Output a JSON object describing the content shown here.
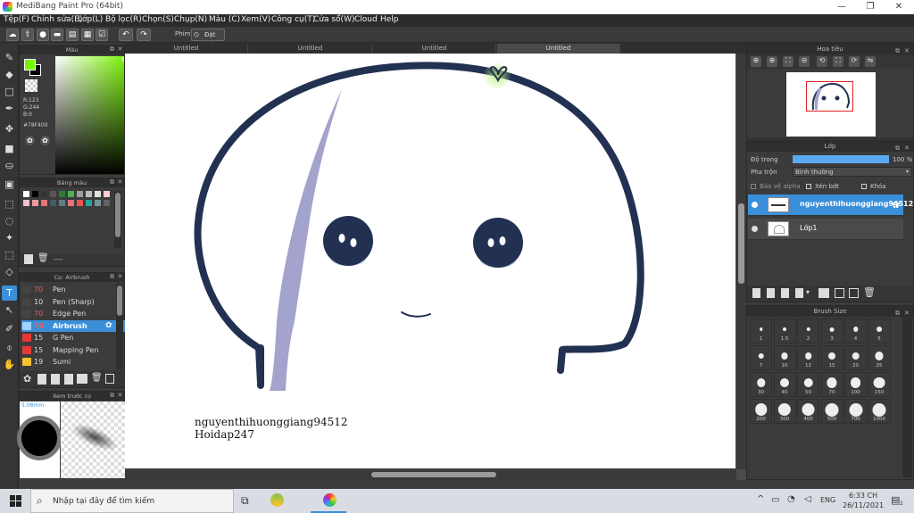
{
  "window": {
    "title": "MediBang Paint Pro (64bit)",
    "controls": [
      "—",
      "❐",
      "✕"
    ]
  },
  "menu": [
    "Tệp(F)",
    "Chỉnh sửa(E)",
    "Lớp(L)",
    "Bộ lọc(R)",
    "Chọn(S)",
    "Chụp(N)",
    "Màu (C)",
    "Xem(V)",
    "Công cụ(T)",
    "Cửa sổ(W)",
    "Cloud",
    "Help"
  ],
  "toolbar": {
    "keys_label": "Phím",
    "reset_label": "Đặt lại"
  },
  "color_panel": {
    "title": "Màu",
    "r": "R:123",
    "g": "G:244",
    "b": "B:0",
    "hex": "#78F400",
    "current_color": "#78f400"
  },
  "palette_panel": {
    "title": "Bảng màu",
    "swatches": [
      "#ffffff",
      "#000000",
      "#333333",
      "#555555",
      "#2e7d32",
      "#4caf50",
      "#9e9e9e",
      "#bdbdbd",
      "#e0e0e0",
      "#ffcdd2",
      "#f8bbd0",
      "#ef9a9a",
      "#e57373",
      "#455a64",
      "#607d8b",
      "#e57373",
      "#ef5350",
      "#26a69a",
      "#78909c",
      "#616161"
    ],
    "dash": "----"
  },
  "brush_panel": {
    "title": "Cọ: Airbrush",
    "items": [
      {
        "size": "70",
        "name": "Pen",
        "color": "#444444"
      },
      {
        "size": "10",
        "name": "Pen (Sharp)",
        "color": "#444444"
      },
      {
        "size": "70",
        "name": "Edge Pen",
        "color": "#444444"
      },
      {
        "size": "70",
        "name": "Airbrush",
        "color": "#9fd3ff"
      },
      {
        "size": "15",
        "name": "G Pen",
        "color": "#e53935"
      },
      {
        "size": "15",
        "name": "Mapping Pen",
        "color": "#e53935"
      },
      {
        "size": "19",
        "name": "Sumi",
        "color": "#fbc02d"
      }
    ]
  },
  "preview_panel": {
    "title": "Xem trước cọ",
    "size": "5.08mm"
  },
  "tabs": [
    "Untitled",
    "Untitled",
    "Untitled",
    "Untitled"
  ],
  "canvas": {
    "signature_line1": "nguyenthihuonggiang94512",
    "signature_line2": "Hoidap247"
  },
  "navigator": {
    "title": "Hoa tiêu"
  },
  "layer_panel": {
    "title": "Lớp",
    "opacity_label": "Độ trong",
    "opacity_value": "100 %",
    "opacity": 1.0,
    "blend_label": "Pha trộn",
    "blend_value": "Bình thường",
    "protect_alpha": "Bảo vệ alpha",
    "clipping": "Xén bớt",
    "lock": "Khóa",
    "layers": [
      {
        "name": "nguyenthihuonggiang94512",
        "selected": true
      },
      {
        "name": "Lớp1",
        "selected": false
      }
    ]
  },
  "brush_size_panel": {
    "title": "Brush Size",
    "sizes": [
      "1",
      "1.5",
      "2",
      "3",
      "4",
      "5",
      "7",
      "10",
      "12",
      "15",
      "20",
      "25",
      "30",
      "40",
      "50",
      "70",
      "100",
      "150",
      "200",
      "300",
      "400",
      "500",
      "700",
      "1000"
    ]
  },
  "taskbar": {
    "search_placeholder": "Nhập tại đây để tìm kiếm",
    "lang": "ENG",
    "time": "6:33 CH",
    "date": "26/11/2021",
    "notifications": "2"
  }
}
